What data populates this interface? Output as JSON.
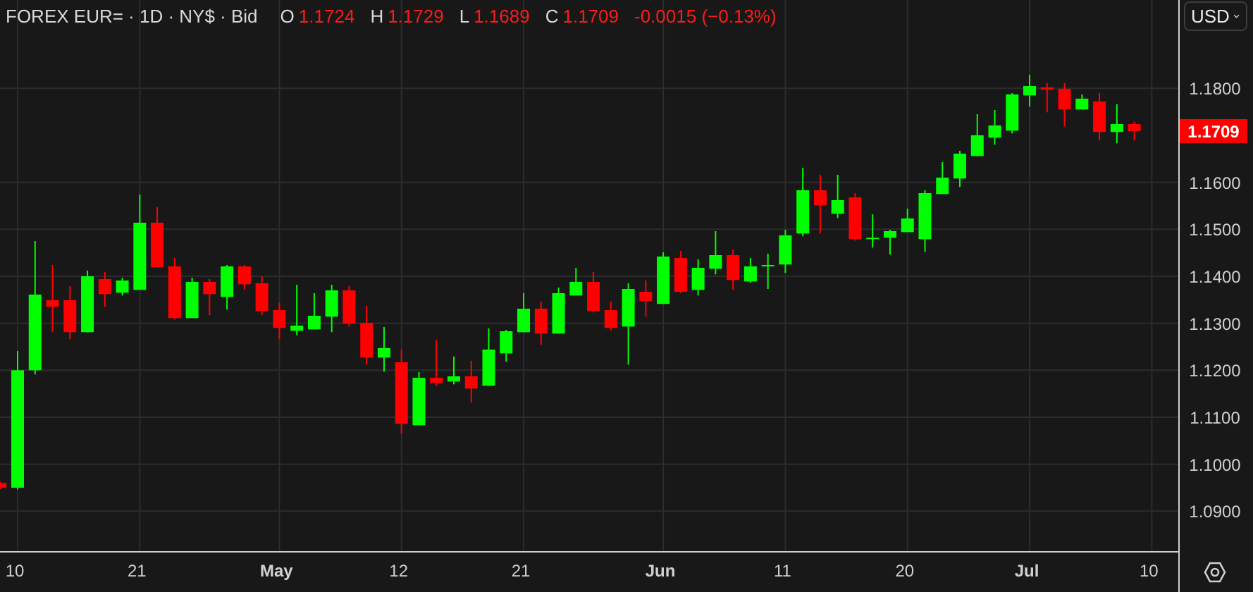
{
  "header": {
    "title": "FOREX EUR= · 1D · NY$ · Bid",
    "ohlc": [
      {
        "label": "O",
        "value": "1.1724"
      },
      {
        "label": "H",
        "value": "1.1729"
      },
      {
        "label": "L",
        "value": "1.1689"
      },
      {
        "label": "C",
        "value": "1.1709"
      }
    ],
    "change": "-0.0015 (−0.13%)"
  },
  "currency_button": "USD",
  "last_price_label": "1.1709",
  "chart_data": {
    "type": "candlestick",
    "grid": true,
    "ylim": [
      1.0815,
      1.1988
    ],
    "categories": [
      null,
      "10",
      null,
      null,
      null,
      null,
      null,
      null,
      "21",
      null,
      null,
      null,
      null,
      null,
      null,
      null,
      "May",
      null,
      null,
      null,
      null,
      null,
      null,
      "12",
      null,
      null,
      null,
      null,
      null,
      null,
      "21",
      null,
      null,
      null,
      null,
      null,
      null,
      null,
      "Jun",
      null,
      null,
      null,
      null,
      null,
      null,
      "11",
      null,
      null,
      null,
      null,
      null,
      null,
      "20",
      null,
      null,
      null,
      null,
      null,
      null,
      "Jul",
      null,
      null,
      null,
      null,
      null,
      null,
      "10"
    ],
    "ohlc": [
      [
        1.096,
        1.0963,
        1.0947,
        1.095
      ],
      [
        1.095,
        1.1241,
        1.0946,
        1.12
      ],
      [
        1.12,
        1.1475,
        1.1191,
        1.1361
      ],
      [
        1.1349,
        1.1424,
        1.1281,
        1.1335
      ],
      [
        1.1349,
        1.1379,
        1.1266,
        1.1281
      ],
      [
        1.1281,
        1.1412,
        1.1281,
        1.14
      ],
      [
        1.1394,
        1.1409,
        1.1335,
        1.1362
      ],
      [
        1.1365,
        1.1397,
        1.1359,
        1.1391
      ],
      [
        1.1371,
        1.1574,
        1.1371,
        1.1514
      ],
      [
        1.1514,
        1.1547,
        1.1419,
        1.1419
      ],
      [
        1.1421,
        1.1439,
        1.1308,
        1.1311
      ],
      [
        1.1311,
        1.1397,
        1.1311,
        1.1388
      ],
      [
        1.1388,
        1.1394,
        1.1317,
        1.1362
      ],
      [
        1.1356,
        1.1424,
        1.1329,
        1.1421
      ],
      [
        1.1421,
        1.1424,
        1.1371,
        1.1383
      ],
      [
        1.1385,
        1.14,
        1.1317,
        1.1326
      ],
      [
        1.1328,
        1.1344,
        1.1266,
        1.129
      ],
      [
        1.1284,
        1.1382,
        1.1275,
        1.1295
      ],
      [
        1.1287,
        1.1364,
        1.1287,
        1.1316
      ],
      [
        1.1314,
        1.1382,
        1.1281,
        1.137
      ],
      [
        1.137,
        1.1379,
        1.1293,
        1.1299
      ],
      [
        1.1301,
        1.1337,
        1.1212,
        1.1227
      ],
      [
        1.1227,
        1.1292,
        1.1197,
        1.1247
      ],
      [
        1.1217,
        1.1244,
        1.1065,
        1.1086
      ],
      [
        1.1083,
        1.1196,
        1.1083,
        1.1184
      ],
      [
        1.1184,
        1.1265,
        1.1167,
        1.1173
      ],
      [
        1.1176,
        1.1229,
        1.117,
        1.1187
      ],
      [
        1.1187,
        1.122,
        1.1131,
        1.1161
      ],
      [
        1.1167,
        1.1289,
        1.1167,
        1.1244
      ],
      [
        1.1236,
        1.1286,
        1.1218,
        1.1283
      ],
      [
        1.1281,
        1.1364,
        1.1281,
        1.1331
      ],
      [
        1.1331,
        1.1346,
        1.1254,
        1.1278
      ],
      [
        1.1278,
        1.1376,
        1.1278,
        1.1364
      ],
      [
        1.1359,
        1.1418,
        1.1359,
        1.1388
      ],
      [
        1.1388,
        1.1409,
        1.1323,
        1.1326
      ],
      [
        1.1328,
        1.1346,
        1.1284,
        1.129
      ],
      [
        1.1293,
        1.1385,
        1.1212,
        1.1373
      ],
      [
        1.1367,
        1.1391,
        1.1314,
        1.1347
      ],
      [
        1.1341,
        1.1451,
        1.1341,
        1.1442
      ],
      [
        1.1439,
        1.1454,
        1.1364,
        1.1367
      ],
      [
        1.1371,
        1.1436,
        1.1359,
        1.1418
      ],
      [
        1.1416,
        1.1496,
        1.1404,
        1.1445
      ],
      [
        1.1445,
        1.1457,
        1.1371,
        1.1392
      ],
      [
        1.1389,
        1.1439,
        1.1386,
        1.1421
      ],
      [
        1.1422,
        1.1448,
        1.1373,
        1.1424
      ],
      [
        1.1425,
        1.1499,
        1.1407,
        1.1487
      ],
      [
        1.1491,
        1.1631,
        1.1485,
        1.1583
      ],
      [
        1.1583,
        1.1616,
        1.1491,
        1.1551
      ],
      [
        1.1533,
        1.1616,
        1.1524,
        1.1562
      ],
      [
        1.1568,
        1.1577,
        1.1476,
        1.1479
      ],
      [
        1.148,
        1.1532,
        1.1461,
        1.1482
      ],
      [
        1.1482,
        1.1499,
        1.1446,
        1.1496
      ],
      [
        1.1494,
        1.1544,
        1.1494,
        1.1523
      ],
      [
        1.1479,
        1.1583,
        1.1452,
        1.1577
      ],
      [
        1.1575,
        1.1643,
        1.1575,
        1.161
      ],
      [
        1.1608,
        1.1667,
        1.159,
        1.1661
      ],
      [
        1.1656,
        1.1745,
        1.1656,
        1.17
      ],
      [
        1.1695,
        1.1754,
        1.168,
        1.1721
      ],
      [
        1.171,
        1.179,
        1.1704,
        1.1787
      ],
      [
        1.1785,
        1.1829,
        1.1761,
        1.1805
      ],
      [
        1.1802,
        1.1811,
        1.1749,
        1.1797
      ],
      [
        1.1799,
        1.1811,
        1.1719,
        1.1755
      ],
      [
        1.1755,
        1.1787,
        1.1755,
        1.1778
      ],
      [
        1.1772,
        1.179,
        1.1689,
        1.1707
      ],
      [
        1.1707,
        1.1766,
        1.1683,
        1.1724
      ],
      [
        1.1724,
        1.1729,
        1.1689,
        1.1709
      ],
      null
    ],
    "yticks": [
      {
        "value": 1.18,
        "label": "1.1800"
      },
      {
        "value": 1.16,
        "label": "1.1600"
      },
      {
        "value": 1.15,
        "label": "1.1500"
      },
      {
        "value": 1.14,
        "label": "1.1400"
      },
      {
        "value": 1.13,
        "label": "1.1300"
      },
      {
        "value": 1.12,
        "label": "1.1200"
      },
      {
        "value": 1.11,
        "label": "1.1100"
      },
      {
        "value": 1.1,
        "label": "1.1000"
      },
      {
        "value": 1.09,
        "label": "1.0900"
      }
    ]
  }
}
